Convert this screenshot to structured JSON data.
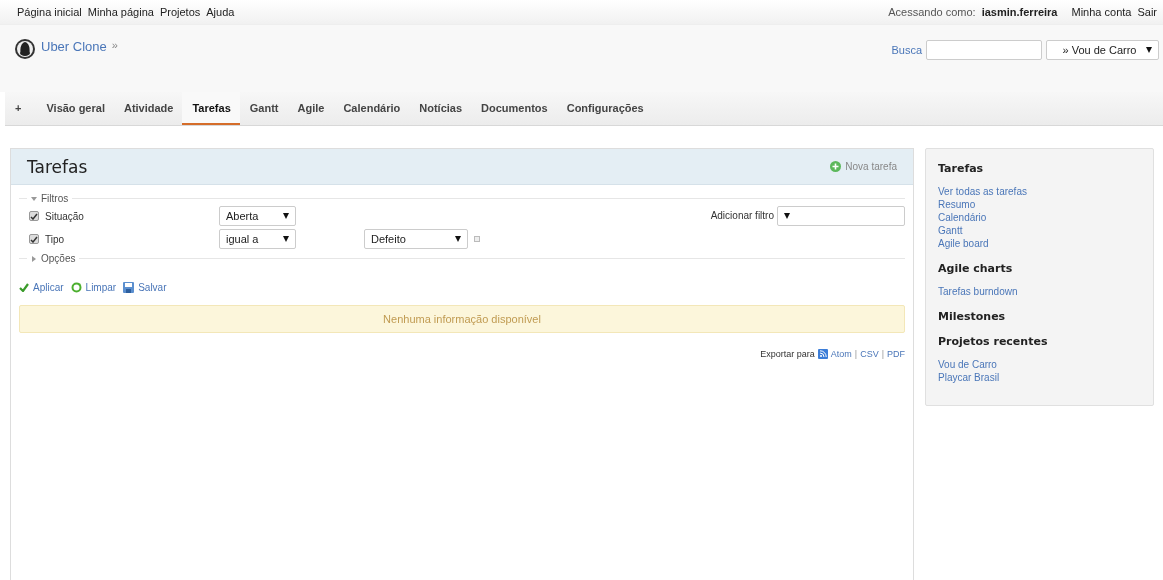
{
  "top_menu": {
    "links": [
      "Página inicial",
      "Minha página",
      "Projetos",
      "Ajuda"
    ],
    "logged_as_label": "Acessando como:",
    "user": "iasmin.ferreira",
    "account_links": [
      "Minha conta",
      "Sair"
    ]
  },
  "header": {
    "project": "Uber Clone",
    "breadcrumb_sep": "»",
    "search_label": "Busca",
    "project_jump": "» Vou de Carro"
  },
  "tabs": [
    {
      "label": "+",
      "selected": false
    },
    {
      "label": "Visão geral",
      "selected": false
    },
    {
      "label": "Atividade",
      "selected": false
    },
    {
      "label": "Tarefas",
      "selected": true
    },
    {
      "label": "Gantt",
      "selected": false
    },
    {
      "label": "Agile",
      "selected": false
    },
    {
      "label": "Calendário",
      "selected": false
    },
    {
      "label": "Notícias",
      "selected": false
    },
    {
      "label": "Documentos",
      "selected": false
    },
    {
      "label": "Configurações",
      "selected": false
    }
  ],
  "main": {
    "title": "Tarefas",
    "new_issue": "Nova tarefa",
    "filters": {
      "legend": "Filtros",
      "expanded": true,
      "rows": [
        {
          "label": "Situação",
          "checked": true,
          "operator": "Aberta"
        },
        {
          "label": "Tipo",
          "checked": true,
          "operator": "igual a",
          "value": "Defeito"
        }
      ],
      "add_filter_label": "Adicionar filtro"
    },
    "options": {
      "legend": "Opções",
      "expanded": false
    },
    "actions": [
      {
        "kind": "apply",
        "label": "Aplicar"
      },
      {
        "kind": "clear",
        "label": "Limpar"
      },
      {
        "kind": "save",
        "label": "Salvar"
      }
    ],
    "empty_message": "Nenhuma informação disponível",
    "export": {
      "label": "Exportar para",
      "formats": [
        "Atom",
        "CSV",
        "PDF"
      ],
      "separators": [
        "|",
        "|"
      ]
    }
  },
  "sidebar": [
    {
      "heading": "Tarefas",
      "links": [
        "Ver todas as tarefas",
        "Resumo",
        "Calendário",
        "Gantt",
        "Agile board"
      ]
    },
    {
      "heading": "Agile charts",
      "links": [
        "Tarefas burndown"
      ]
    },
    {
      "heading": "Milestones"
    },
    {
      "heading": "Projetos recentes",
      "links": [
        "Vou de Carro",
        "Playcar Brasil"
      ]
    }
  ]
}
